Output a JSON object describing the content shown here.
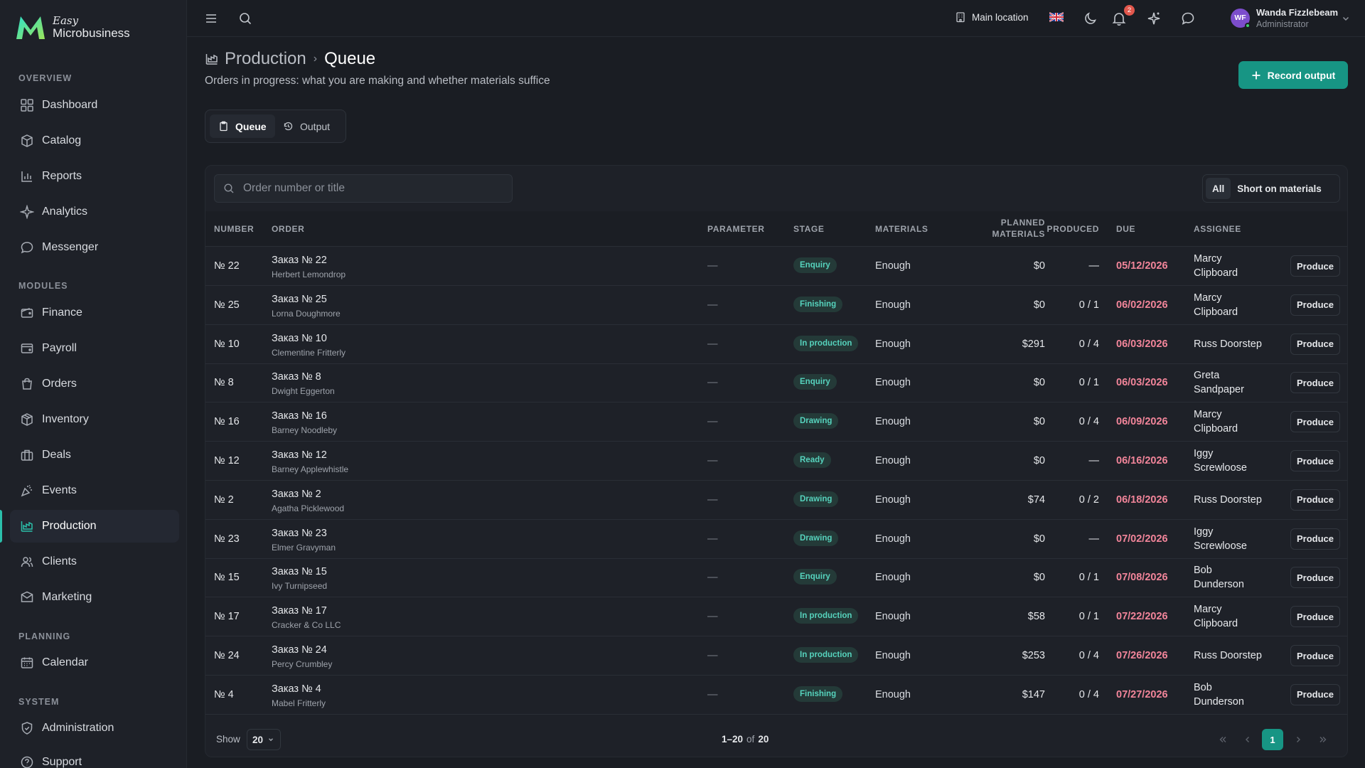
{
  "brand": {
    "small": "Easy",
    "name": "Microbusiness"
  },
  "sidebar": {
    "sections": [
      {
        "title": "OVERVIEW"
      },
      {
        "title": "MODULES"
      },
      {
        "title": "PLANNING"
      },
      {
        "title": "SYSTEM"
      }
    ],
    "items": [
      {
        "label": "Dashboard",
        "icon": "dashboard-icon"
      },
      {
        "label": "Catalog",
        "icon": "catalog-icon"
      },
      {
        "label": "Reports",
        "icon": "reports-icon"
      },
      {
        "label": "Analytics",
        "icon": "analytics-icon"
      },
      {
        "label": "Messenger",
        "icon": "messenger-icon"
      },
      {
        "label": "Finance",
        "icon": "finance-icon"
      },
      {
        "label": "Payroll",
        "icon": "payroll-icon"
      },
      {
        "label": "Orders",
        "icon": "orders-icon"
      },
      {
        "label": "Inventory",
        "icon": "inventory-icon"
      },
      {
        "label": "Deals",
        "icon": "deals-icon"
      },
      {
        "label": "Events",
        "icon": "events-icon"
      },
      {
        "label": "Production",
        "icon": "production-icon",
        "active": true
      },
      {
        "label": "Clients",
        "icon": "clients-icon"
      },
      {
        "label": "Marketing",
        "icon": "marketing-icon"
      },
      {
        "label": "Calendar",
        "icon": "calendar-icon"
      },
      {
        "label": "Administration",
        "icon": "administration-icon"
      },
      {
        "label": "Support",
        "icon": "support-icon"
      }
    ]
  },
  "topbar": {
    "location": "Main location",
    "notification_count": "2",
    "user": {
      "initials": "WF",
      "name": "Wanda Fizzlebeam",
      "role": "Administrator"
    }
  },
  "page": {
    "breadcrumb_parent": "Production",
    "breadcrumb_current": "Queue",
    "subtitle": "Orders in progress: what you are making and whether materials suffice",
    "record_button": "Record output",
    "tabs": [
      {
        "label": "Queue",
        "active": true
      },
      {
        "label": "Output"
      }
    ]
  },
  "search": {
    "placeholder": "Order number or title"
  },
  "filters": [
    {
      "label": "All",
      "active": true
    },
    {
      "label": "Short on materials"
    }
  ],
  "table": {
    "headers": {
      "number": "NUMBER",
      "order": "ORDER",
      "parameter": "PARAMETER",
      "stage": "STAGE",
      "materials": "MATERIALS",
      "planned_1": "PLANNED",
      "planned_2": "MATERIALS",
      "produced": "PRODUCED",
      "due": "DUE",
      "assignee": "ASSIGNEE"
    },
    "action_label": "Produce",
    "rows": [
      {
        "number": "№ 22",
        "title": "Заказ № 22",
        "client": "Herbert Lemondrop",
        "parameter": "—",
        "stage": "Enquiry",
        "materials": "Enough",
        "planned": "$0",
        "produced": "—",
        "due": "05/12/2026",
        "assignee_1": "Marcy",
        "assignee_2": "Clipboard"
      },
      {
        "number": "№ 25",
        "title": "Заказ № 25",
        "client": "Lorna Doughmore",
        "parameter": "—",
        "stage": "Finishing",
        "materials": "Enough",
        "planned": "$0",
        "produced": "0 / 1",
        "due": "06/02/2026",
        "assignee_1": "Marcy",
        "assignee_2": "Clipboard"
      },
      {
        "number": "№ 10",
        "title": "Заказ № 10",
        "client": "Clementine Fritterly",
        "parameter": "—",
        "stage": "In production",
        "materials": "Enough",
        "planned": "$291",
        "produced": "0 / 4",
        "due": "06/03/2026",
        "assignee_1": "Russ Doorstep",
        "assignee_2": ""
      },
      {
        "number": "№ 8",
        "title": "Заказ № 8",
        "client": "Dwight Eggerton",
        "parameter": "—",
        "stage": "Enquiry",
        "materials": "Enough",
        "planned": "$0",
        "produced": "0 / 1",
        "due": "06/03/2026",
        "assignee_1": "Greta",
        "assignee_2": "Sandpaper"
      },
      {
        "number": "№ 16",
        "title": "Заказ № 16",
        "client": "Barney Noodleby",
        "parameter": "—",
        "stage": "Drawing",
        "materials": "Enough",
        "planned": "$0",
        "produced": "0 / 4",
        "due": "06/09/2026",
        "assignee_1": "Marcy",
        "assignee_2": "Clipboard"
      },
      {
        "number": "№ 12",
        "title": "Заказ № 12",
        "client": "Barney Applewhistle",
        "parameter": "—",
        "stage": "Ready",
        "materials": "Enough",
        "planned": "$0",
        "produced": "—",
        "due": "06/16/2026",
        "assignee_1": "Iggy",
        "assignee_2": "Screwloose"
      },
      {
        "number": "№ 2",
        "title": "Заказ № 2",
        "client": "Agatha Picklewood",
        "parameter": "—",
        "stage": "Drawing",
        "materials": "Enough",
        "planned": "$74",
        "produced": "0 / 2",
        "due": "06/18/2026",
        "assignee_1": "Russ Doorstep",
        "assignee_2": ""
      },
      {
        "number": "№ 23",
        "title": "Заказ № 23",
        "client": "Elmer Gravyman",
        "parameter": "—",
        "stage": "Drawing",
        "materials": "Enough",
        "planned": "$0",
        "produced": "—",
        "due": "07/02/2026",
        "assignee_1": "Iggy",
        "assignee_2": "Screwloose"
      },
      {
        "number": "№ 15",
        "title": "Заказ № 15",
        "client": "Ivy Turnipseed",
        "parameter": "—",
        "stage": "Enquiry",
        "materials": "Enough",
        "planned": "$0",
        "produced": "0 / 1",
        "due": "07/08/2026",
        "assignee_1": "Bob",
        "assignee_2": "Dunderson"
      },
      {
        "number": "№ 17",
        "title": "Заказ № 17",
        "client": "Cracker & Co LLC",
        "parameter": "—",
        "stage": "In production",
        "materials": "Enough",
        "planned": "$58",
        "produced": "0 / 1",
        "due": "07/22/2026",
        "assignee_1": "Marcy",
        "assignee_2": "Clipboard"
      },
      {
        "number": "№ 24",
        "title": "Заказ № 24",
        "client": "Percy Crumbley",
        "parameter": "—",
        "stage": "In production",
        "materials": "Enough",
        "planned": "$253",
        "produced": "0 / 4",
        "due": "07/26/2026",
        "assignee_1": "Russ Doorstep",
        "assignee_2": ""
      },
      {
        "number": "№ 4",
        "title": "Заказ № 4",
        "client": "Mabel Fritterly",
        "parameter": "—",
        "stage": "Finishing",
        "materials": "Enough",
        "planned": "$147",
        "produced": "0 / 4",
        "due": "07/27/2026",
        "assignee_1": "Bob",
        "assignee_2": "Dunderson"
      }
    ]
  },
  "footer": {
    "show_label": "Show",
    "page_size": "20",
    "range": "1–20",
    "of": "of",
    "total": "20",
    "current_page": "1"
  },
  "colors": {
    "accent": "#179584",
    "due": "#f2859a",
    "stage_text": "#56d3bd"
  }
}
